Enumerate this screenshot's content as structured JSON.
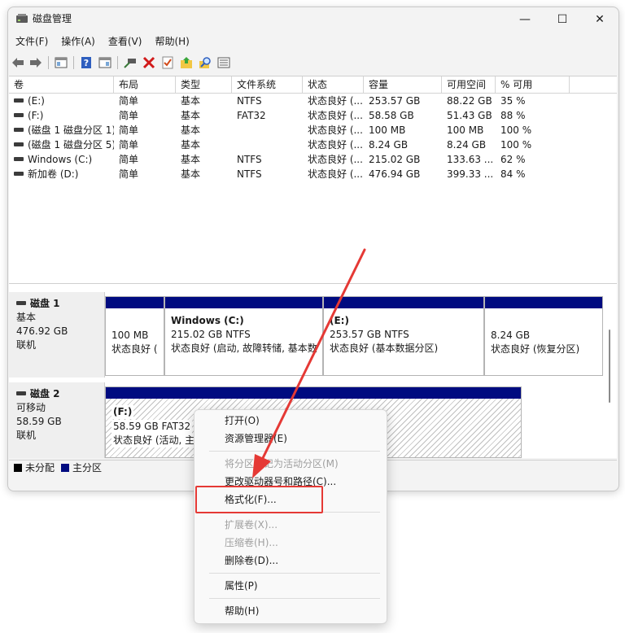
{
  "window": {
    "title": "磁盘管理",
    "minimize_glyph": "—",
    "maximize_glyph": "☐",
    "close_glyph": "✕"
  },
  "menu": [
    "文件(F)",
    "操作(A)",
    "查看(V)",
    "帮助(H)"
  ],
  "toolbar_icons": [
    "back-arrow-icon",
    "forward-arrow-icon",
    "console-tree-icon",
    "help-icon",
    "properties-icon",
    "connect-icon",
    "delete-icon",
    "check-icon",
    "folder-icon",
    "search-icon",
    "list-icon"
  ],
  "volume_list": {
    "columns": [
      "卷",
      "布局",
      "类型",
      "文件系统",
      "状态",
      "容量",
      "可用空间",
      "% 可用"
    ],
    "rows": [
      [
        "(E:)",
        "简单",
        "基本",
        "NTFS",
        "状态良好 (...",
        "253.57 GB",
        "88.22 GB",
        "35 %"
      ],
      [
        "(F:)",
        "简单",
        "基本",
        "FAT32",
        "状态良好 (...",
        "58.58 GB",
        "51.43 GB",
        "88 %"
      ],
      [
        "(磁盘 1 磁盘分区 1)",
        "简单",
        "基本",
        "",
        "状态良好 (...",
        "100 MB",
        "100 MB",
        "100 %"
      ],
      [
        "(磁盘 1 磁盘分区 5)",
        "简单",
        "基本",
        "",
        "状态良好 (...",
        "8.24 GB",
        "8.24 GB",
        "100 %"
      ],
      [
        "Windows (C:)",
        "简单",
        "基本",
        "NTFS",
        "状态良好 (...",
        "215.02 GB",
        "133.63 ...",
        "62 %"
      ],
      [
        "新加卷 (D:)",
        "简单",
        "基本",
        "NTFS",
        "状态良好 (...",
        "476.94 GB",
        "399.33 ...",
        "84 %"
      ]
    ]
  },
  "disks": [
    {
      "name": "磁盘 1",
      "type": "基本",
      "size": "476.92 GB",
      "status": "联机",
      "partitions": [
        {
          "title": "",
          "line1": "100 MB",
          "line2": "状态良好 ("
        },
        {
          "title": "Windows  (C:)",
          "line1": "215.02 GB NTFS",
          "line2": "状态良好 (启动, 故障转储, 基本数"
        },
        {
          "title": "(E:)",
          "line1": "253.57 GB NTFS",
          "line2": "状态良好 (基本数据分区)"
        },
        {
          "title": "",
          "line1": "8.24 GB",
          "line2": "状态良好 (恢复分区)"
        }
      ]
    },
    {
      "name": "磁盘 2",
      "type": "可移动",
      "size": "58.59 GB",
      "status": "联机",
      "partitions": [
        {
          "title": "(F:)",
          "line1": "58.59 GB FAT32",
          "line2": "状态良好 (活动, 主分区)"
        }
      ]
    }
  ],
  "legend": [
    {
      "label": "未分配",
      "color": "#000000"
    },
    {
      "label": "主分区",
      "color": "#000b80"
    }
  ],
  "context_menu": {
    "items": [
      {
        "label": "打开(O)",
        "enabled": true
      },
      {
        "label": "资源管理器(E)",
        "enabled": true
      },
      {
        "label": "将分区标记为活动分区(M)",
        "enabled": false
      },
      {
        "label": "更改驱动器号和路径(C)...",
        "enabled": true
      },
      {
        "label": "格式化(F)...",
        "enabled": true,
        "highlighted": true
      },
      {
        "label": "扩展卷(X)...",
        "enabled": false
      },
      {
        "label": "压缩卷(H)...",
        "enabled": false
      },
      {
        "label": "删除卷(D)...",
        "enabled": true
      },
      {
        "label": "属性(P)",
        "enabled": true
      },
      {
        "label": "帮助(H)",
        "enabled": true
      }
    ]
  },
  "colors": {
    "partition_bar": "#000b80",
    "annotation": "#e53935"
  }
}
